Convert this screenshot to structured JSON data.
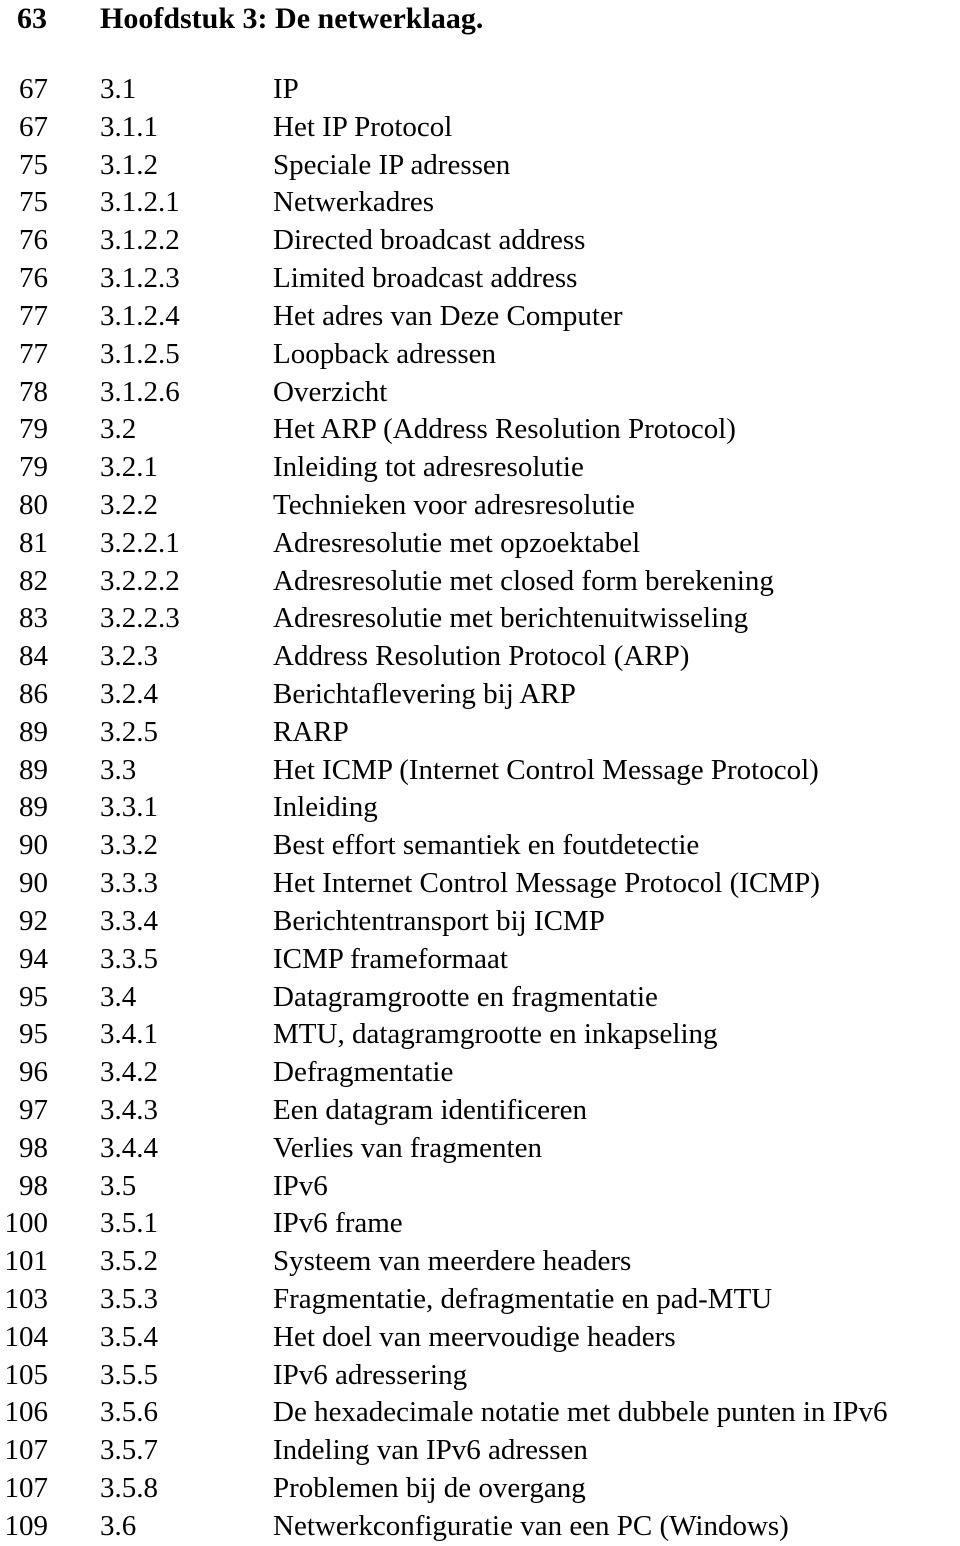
{
  "heading": {
    "page": "63",
    "title": "Hoofdstuk 3: De netwerklaag."
  },
  "entries": [
    {
      "page": "67",
      "num": "3.1",
      "title": "IP"
    },
    {
      "page": "67",
      "num": "3.1.1",
      "title": "Het IP Protocol"
    },
    {
      "page": "75",
      "num": "3.1.2",
      "title": "Speciale IP adressen"
    },
    {
      "page": "75",
      "num": "3.1.2.1",
      "title": "Netwerkadres"
    },
    {
      "page": "76",
      "num": "3.1.2.2",
      "title": "Directed broadcast address"
    },
    {
      "page": "76",
      "num": "3.1.2.3",
      "title": "Limited broadcast address"
    },
    {
      "page": "77",
      "num": "3.1.2.4",
      "title": "Het adres van Deze Computer"
    },
    {
      "page": "77",
      "num": "3.1.2.5",
      "title": "Loopback adressen"
    },
    {
      "page": "78",
      "num": "3.1.2.6",
      "title": "Overzicht"
    },
    {
      "page": "79",
      "num": "3.2",
      "title": "Het ARP (Address Resolution Protocol)"
    },
    {
      "page": "79",
      "num": "3.2.1",
      "title": "Inleiding tot adresresolutie"
    },
    {
      "page": "80",
      "num": "3.2.2",
      "title": "Technieken voor adresresolutie"
    },
    {
      "page": "81",
      "num": "3.2.2.1",
      "title": "Adresresolutie met opzoektabel"
    },
    {
      "page": "82",
      "num": "3.2.2.2",
      "title": "Adresresolutie met closed form berekening"
    },
    {
      "page": "83",
      "num": "3.2.2.3",
      "title": "Adresresolutie met berichtenuitwisseling"
    },
    {
      "page": "84",
      "num": "3.2.3",
      "title": "Address Resolution Protocol (ARP)"
    },
    {
      "page": "86",
      "num": "3.2.4",
      "title": "Berichtaflevering bij ARP"
    },
    {
      "page": "89",
      "num": "3.2.5",
      "title": "RARP"
    },
    {
      "page": "89",
      "num": "3.3",
      "title": "Het ICMP (Internet Control Message Protocol)"
    },
    {
      "page": "89",
      "num": "3.3.1",
      "title": "Inleiding"
    },
    {
      "page": "90",
      "num": "3.3.2",
      "title": "Best effort semantiek en foutdetectie"
    },
    {
      "page": "90",
      "num": "3.3.3",
      "title": "Het Internet Control Message Protocol (ICMP)"
    },
    {
      "page": "92",
      "num": "3.3.4",
      "title": "Berichtentransport bij ICMP"
    },
    {
      "page": "94",
      "num": "3.3.5",
      "title": "ICMP frameformaat"
    },
    {
      "page": "95",
      "num": "3.4",
      "title": "Datagramgrootte en fragmentatie"
    },
    {
      "page": "95",
      "num": "3.4.1",
      "title": "MTU, datagramgrootte en inkapseling"
    },
    {
      "page": "96",
      "num": "3.4.2",
      "title": "Defragmentatie"
    },
    {
      "page": "97",
      "num": "3.4.3",
      "title": "Een datagram identificeren"
    },
    {
      "page": "98",
      "num": "3.4.4",
      "title": "Verlies van fragmenten"
    },
    {
      "page": "98",
      "num": "3.5",
      "title": "IPv6"
    },
    {
      "page": "100",
      "num": "3.5.1",
      "title": "IPv6 frame"
    },
    {
      "page": "101",
      "num": "3.5.2",
      "title": "Systeem van meerdere headers"
    },
    {
      "page": "103",
      "num": "3.5.3",
      "title": "Fragmentatie, defragmentatie en pad-MTU"
    },
    {
      "page": "104",
      "num": "3.5.4",
      "title": "Het doel van meervoudige headers"
    },
    {
      "page": "105",
      "num": "3.5.5",
      "title": "IPv6 adressering"
    },
    {
      "page": "106",
      "num": "3.5.6",
      "title": "De hexadecimale notatie met dubbele punten in IPv6"
    },
    {
      "page": "107",
      "num": "3.5.7",
      "title": "Indeling van IPv6 adressen"
    },
    {
      "page": "107",
      "num": "3.5.8",
      "title": "Problemen bij de overgang"
    },
    {
      "page": "109",
      "num": "3.6",
      "title": "Netwerkconfiguratie van een PC (Windows)"
    }
  ]
}
